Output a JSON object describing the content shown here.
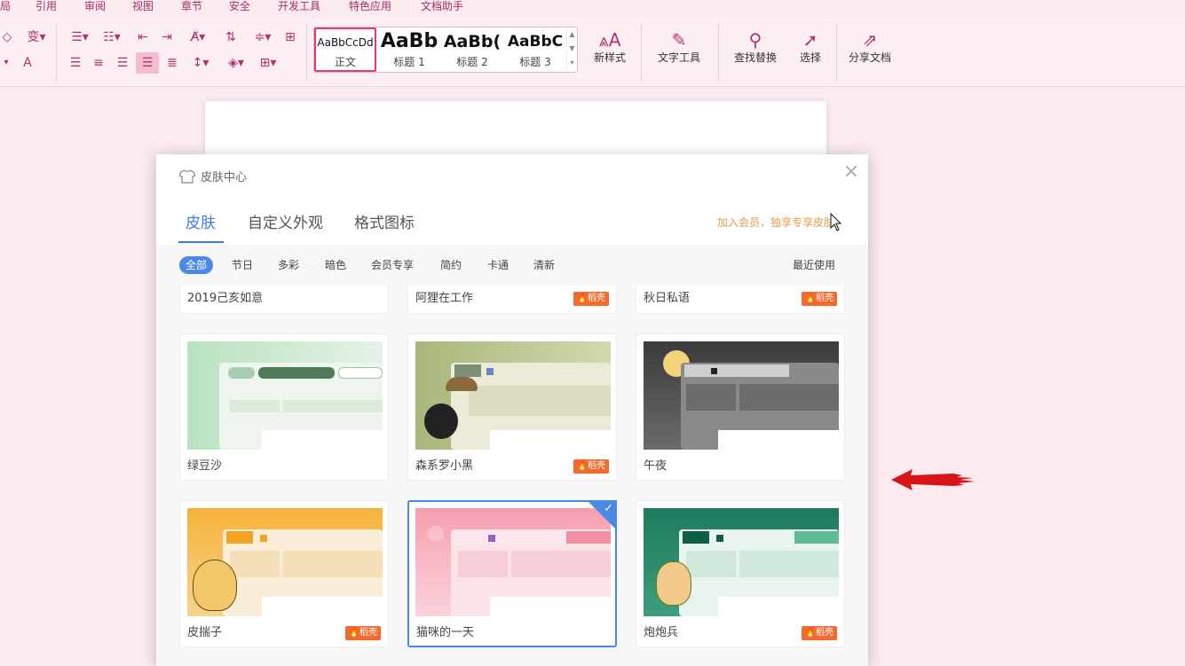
{
  "menu": [
    "局",
    "引用",
    "审阅",
    "视图",
    "章节",
    "安全",
    "开发工具",
    "特色应用",
    "文档助手"
  ],
  "ribbon": {
    "styles": [
      {
        "preview": "AaBbCcDd",
        "label": "正文"
      },
      {
        "preview": "AaBb",
        "label": "标题 1"
      },
      {
        "preview": "AaBb(",
        "label": "标题 2"
      },
      {
        "preview": "AaBbC",
        "label": "标题 3"
      }
    ],
    "new_style": "新样式",
    "text_tools": "文字工具",
    "find_replace": "查找替换",
    "select": "选择",
    "share": "分享文档"
  },
  "dialog": {
    "title": "皮肤中心",
    "close": "×",
    "tabs": [
      "皮肤",
      "自定义外观",
      "格式图标"
    ],
    "promo": "加入会员，独享专享皮肤",
    "filters": [
      "全部",
      "节日",
      "多彩",
      "暗色",
      "会员专享",
      "简约",
      "卡通",
      "清新"
    ],
    "recent": "最近使用",
    "badge_text": "稻壳",
    "skins": [
      {
        "name": "2019己亥如意",
        "badge": false
      },
      {
        "name": "阿狸在工作",
        "badge": true
      },
      {
        "name": "秋日私语",
        "badge": true
      },
      {
        "name": "绿豆沙",
        "badge": false
      },
      {
        "name": "森系罗小黑",
        "badge": true
      },
      {
        "name": "午夜",
        "badge": false
      },
      {
        "name": "皮揣子",
        "badge": true
      },
      {
        "name": "猫咪的一天",
        "badge": false,
        "selected": true
      },
      {
        "name": "炮炮兵",
        "badge": true
      }
    ]
  },
  "colors": {
    "accent": "#4a8ae6",
    "ribbon_icon": "#b0326f",
    "badge": "#f26a2d",
    "arrow": "#d8141b"
  }
}
